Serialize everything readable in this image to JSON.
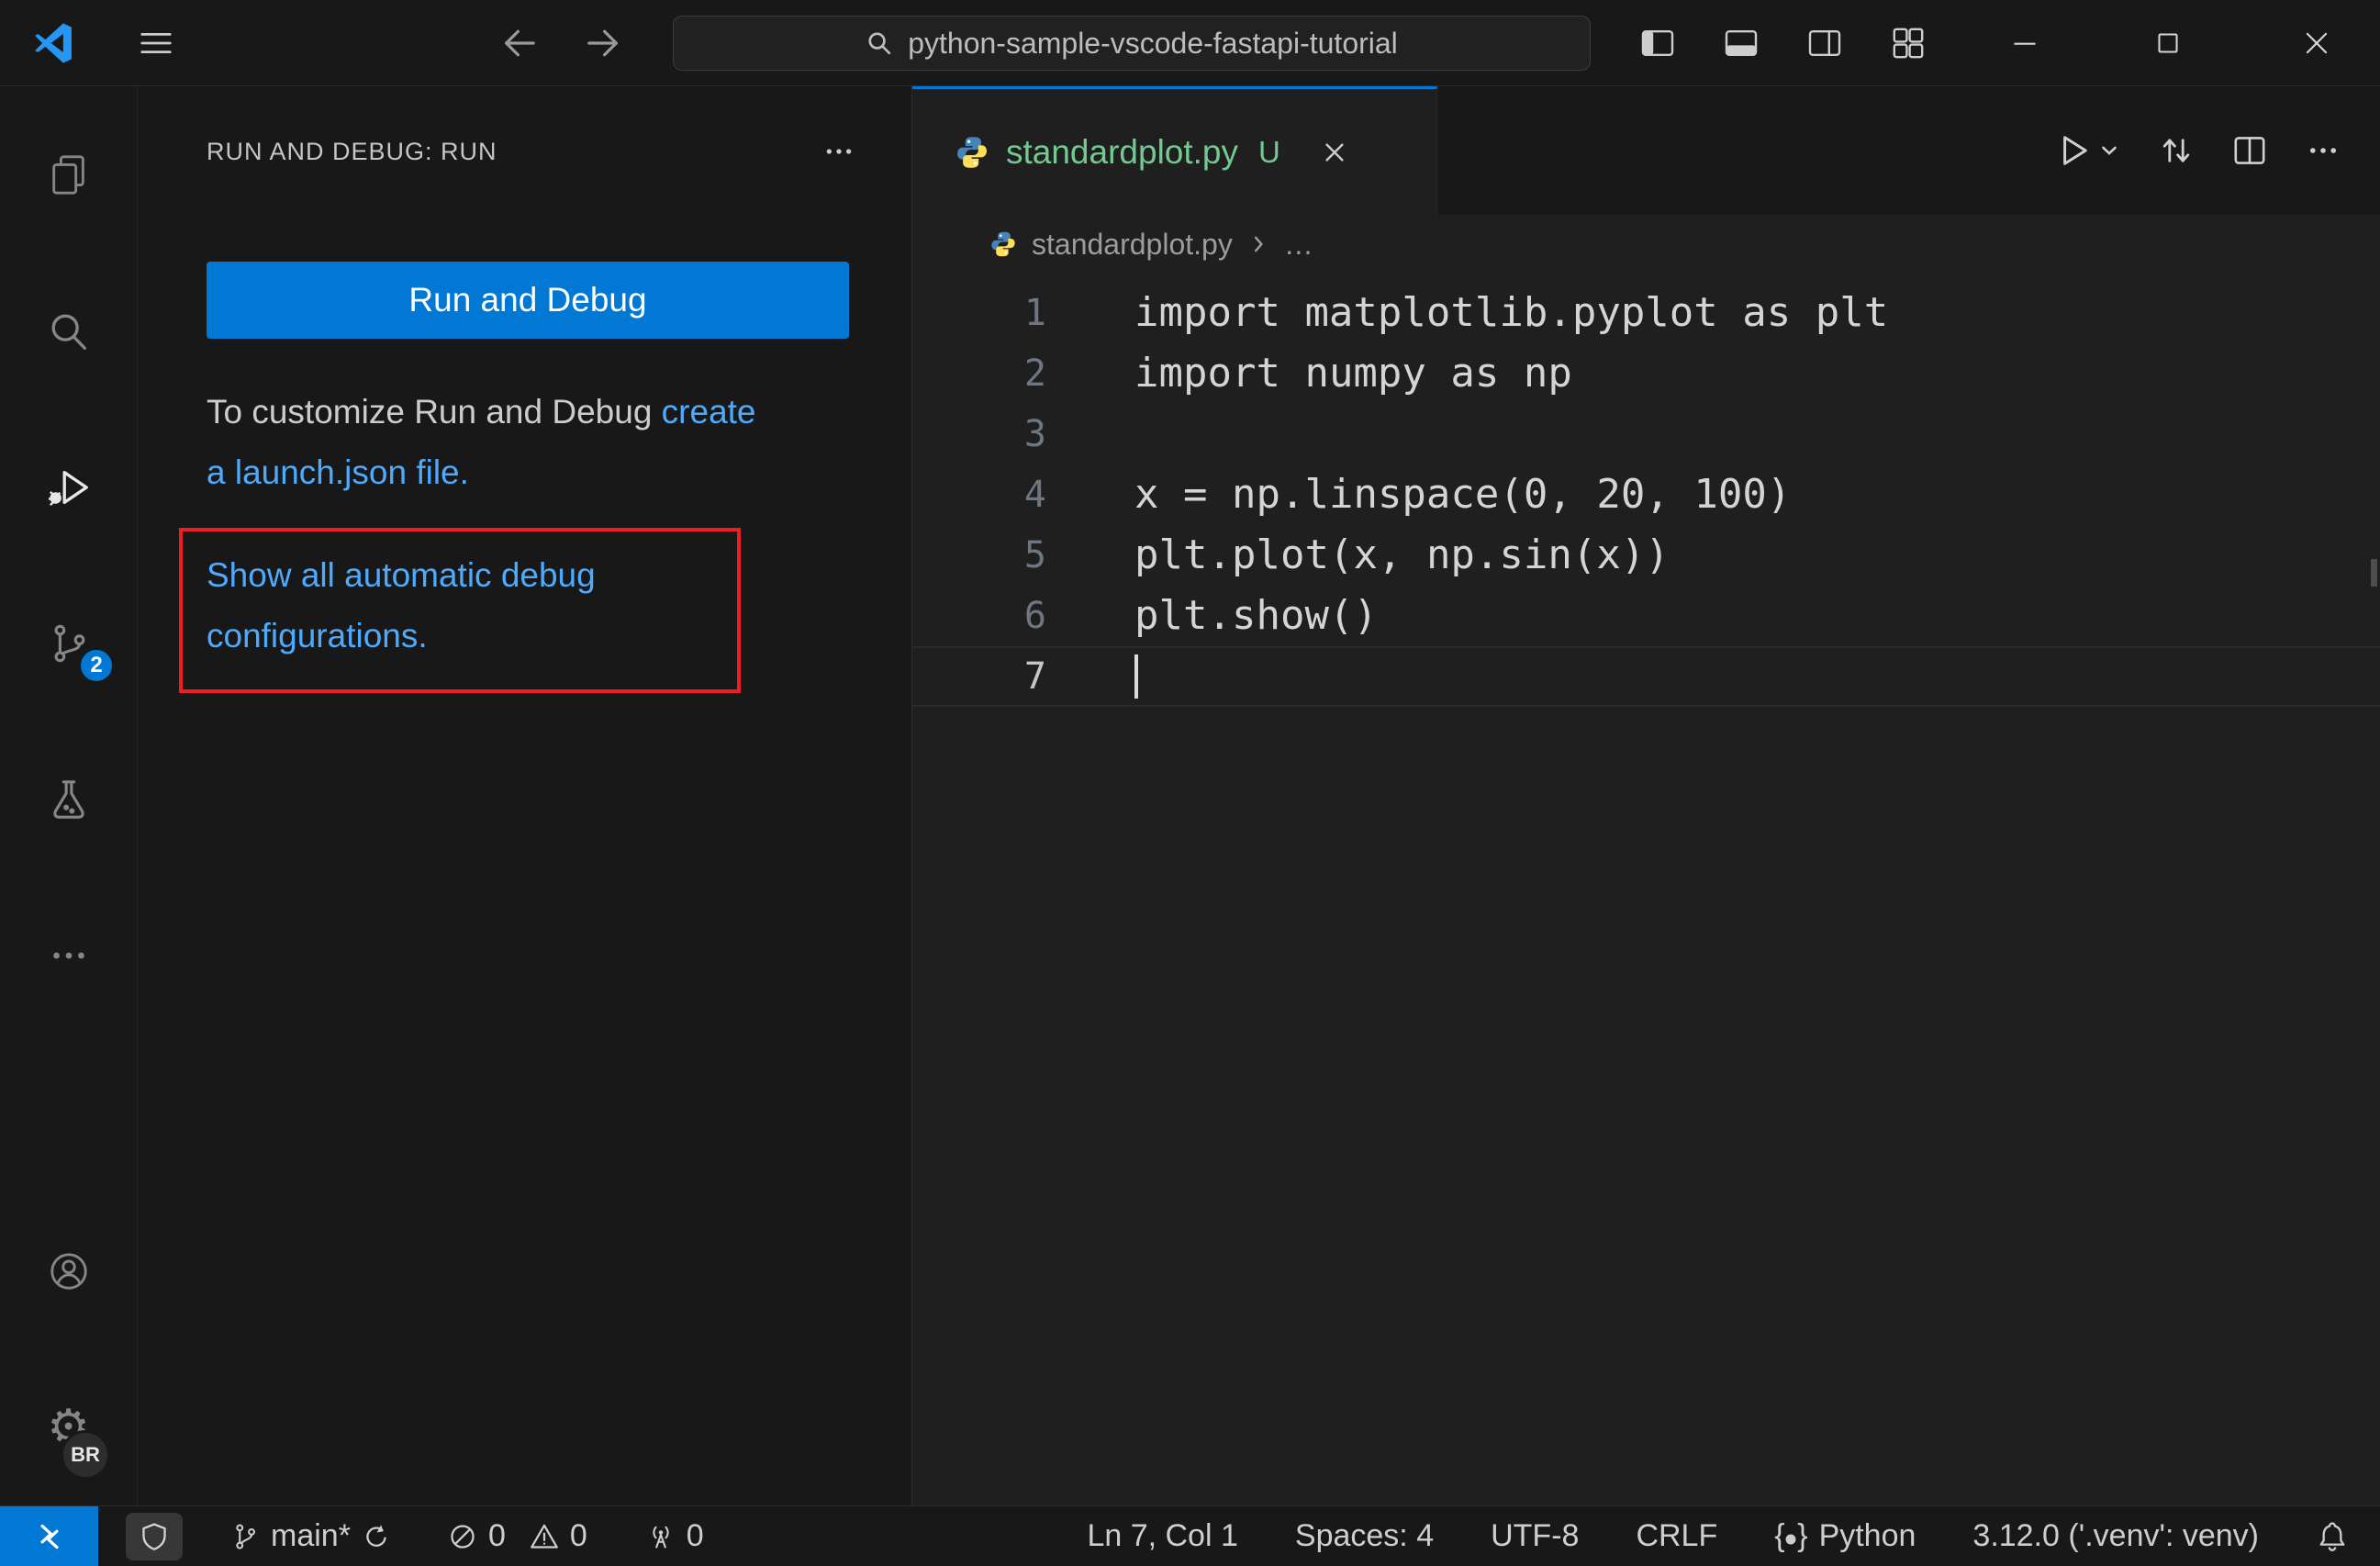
{
  "colors": {
    "accent": "#0078d4",
    "link": "#4daafc",
    "annotation": "#ec1e24",
    "untracked": "#73C991"
  },
  "icons": {
    "gear_glyph": "⚙"
  },
  "title_bar": {
    "command_center_label": "python-sample-vscode-fastapi-tutorial"
  },
  "activity_bar": {
    "scm_badge": "2",
    "profile_badge": "BR"
  },
  "sidebar": {
    "title": "RUN AND DEBUG: RUN",
    "run_button_label": "Run and Debug",
    "customize_text": "To customize Run and Debug ",
    "launch_json_link": "create a launch.json file.",
    "auto_debug_link": "Show all automatic debug configurations."
  },
  "editor": {
    "tab_label": "standardplot.py",
    "tab_badge": "U",
    "breadcrumb_file": "standardplot.py",
    "breadcrumb_more": "…",
    "syntax_colors": {
      "kw": "#C586C0",
      "pl": "#d4d4d4",
      "mod": "#4EC9B0",
      "var": "#9CDCFE",
      "fn": "#DCDCAA",
      "num": "#B5CEA8",
      "p1": "#FFD700",
      "p2": "#DA70D6"
    },
    "code_lines": [
      {
        "tokens": [
          {
            "t": "import",
            "c": "kw"
          },
          {
            "t": " matplotlib.pyplot ",
            "c": "pl"
          },
          {
            "t": "as",
            "c": "kw"
          },
          {
            "t": " plt",
            "c": "pl"
          }
        ]
      },
      {
        "tokens": [
          {
            "t": "import",
            "c": "kw"
          },
          {
            "t": " ",
            "c": "pl"
          },
          {
            "t": "numpy",
            "c": "mod"
          },
          {
            "t": " ",
            "c": "pl"
          },
          {
            "t": "as",
            "c": "kw"
          },
          {
            "t": " ",
            "c": "pl"
          },
          {
            "t": "np",
            "c": "mod"
          }
        ]
      },
      {
        "tokens": []
      },
      {
        "tokens": [
          {
            "t": "x",
            "c": "var"
          },
          {
            "t": " = ",
            "c": "pl"
          },
          {
            "t": "np",
            "c": "mod"
          },
          {
            "t": ".",
            "c": "pl"
          },
          {
            "t": "linspace",
            "c": "fn"
          },
          {
            "t": "(",
            "c": "p1"
          },
          {
            "t": "0",
            "c": "num"
          },
          {
            "t": ", ",
            "c": "pl"
          },
          {
            "t": "20",
            "c": "num"
          },
          {
            "t": ", ",
            "c": "pl"
          },
          {
            "t": "100",
            "c": "num"
          },
          {
            "t": ")",
            "c": "p1"
          }
        ]
      },
      {
        "tokens": [
          {
            "t": "plt",
            "c": "pl"
          },
          {
            "t": ".",
            "c": "pl"
          },
          {
            "t": "plot",
            "c": "fn"
          },
          {
            "t": "(",
            "c": "p1"
          },
          {
            "t": "x",
            "c": "var"
          },
          {
            "t": ", ",
            "c": "pl"
          },
          {
            "t": "np",
            "c": "mod"
          },
          {
            "t": ".",
            "c": "pl"
          },
          {
            "t": "sin",
            "c": "fn"
          },
          {
            "t": "(",
            "c": "p2"
          },
          {
            "t": "x",
            "c": "var"
          },
          {
            "t": ")",
            "c": "p2"
          },
          {
            "t": ")",
            "c": "p1"
          }
        ]
      },
      {
        "tokens": [
          {
            "t": "plt",
            "c": "pl"
          },
          {
            "t": ".",
            "c": "pl"
          },
          {
            "t": "show",
            "c": "fn"
          },
          {
            "t": "(",
            "c": "p1"
          },
          {
            "t": ")",
            "c": "p1"
          }
        ]
      },
      {
        "tokens": [],
        "cursor": true,
        "active": true
      }
    ]
  },
  "status_bar": {
    "branch": "main*",
    "error_count": "0",
    "warning_count": "0",
    "port_count": "0",
    "cursor_position": "Ln 7, Col 1",
    "indentation": "Spaces: 4",
    "encoding": "UTF-8",
    "eol": "CRLF",
    "language": "Python",
    "interpreter": "3.12.0 ('.venv': venv)"
  }
}
